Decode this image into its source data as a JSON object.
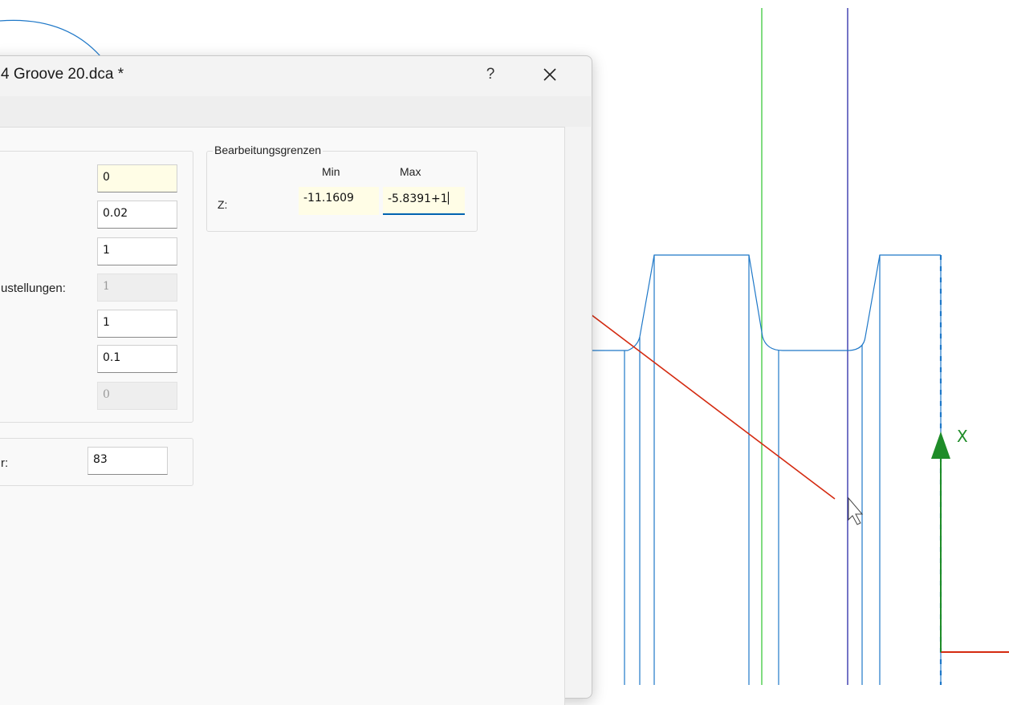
{
  "dialog": {
    "title": "4 Groove 20.dca *",
    "help_label": "?",
    "close_icon": "close-icon"
  },
  "left_group": {
    "values": [
      "0",
      "0.02",
      "1",
      "1",
      "1",
      "0.1",
      "0"
    ],
    "partial_label": "ustellungen:"
  },
  "bottom_group": {
    "partial_label": "r:",
    "value": "83"
  },
  "limits": {
    "legend": "Bearbeitungsgrenzen",
    "min_header": "Min",
    "max_header": "Max",
    "z_label": "Z:",
    "z_min": "-11.1609",
    "z_max": "-5.8391+1"
  },
  "viewport": {
    "axis_label": "X",
    "colors": {
      "toolpath": "#1f78c8",
      "green_line": "#3cc83c",
      "blue_line": "#2a2aa8",
      "red_line": "#d42a10",
      "axis_arrow": "#1e8c28"
    }
  }
}
